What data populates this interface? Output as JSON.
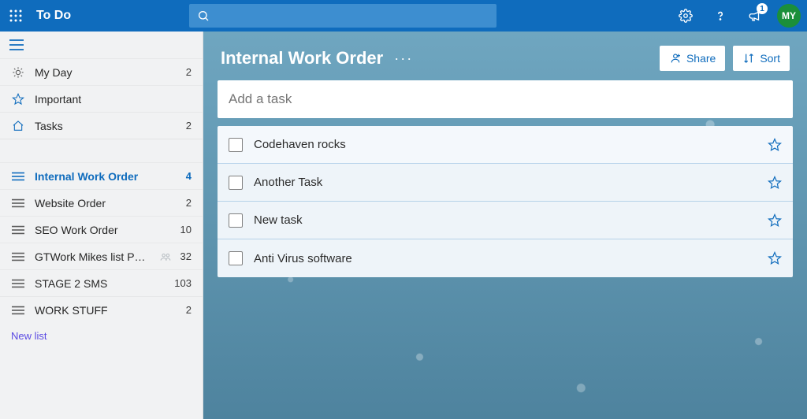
{
  "app": {
    "title": "To Do"
  },
  "header": {
    "notification_count": "1",
    "avatar_initials": "MY"
  },
  "sidebar": {
    "smart_lists": [
      {
        "icon": "sun",
        "label": "My Day",
        "count": "2"
      },
      {
        "icon": "star",
        "label": "Important",
        "count": ""
      },
      {
        "icon": "home",
        "label": "Tasks",
        "count": "2"
      }
    ],
    "lists": [
      {
        "label": "Internal Work Order",
        "count": "4",
        "selected": true
      },
      {
        "label": "Website Order",
        "count": "2",
        "selected": false
      },
      {
        "label": "SEO Work Order",
        "count": "10",
        "selected": false
      },
      {
        "label": "GTWork Mikes list Personal",
        "count": "32",
        "selected": false,
        "shared": true
      },
      {
        "label": "STAGE 2 SMS",
        "count": "103",
        "selected": false
      },
      {
        "label": "WORK STUFF",
        "count": "2",
        "selected": false
      }
    ],
    "new_list_label": "New list"
  },
  "main": {
    "list_title": "Internal Work Order",
    "share_label": "Share",
    "sort_label": "Sort",
    "add_task_placeholder": "Add a task",
    "tasks": [
      {
        "title": "Codehaven rocks"
      },
      {
        "title": "Another Task"
      },
      {
        "title": "New task"
      },
      {
        "title": "Anti Virus software"
      }
    ]
  }
}
